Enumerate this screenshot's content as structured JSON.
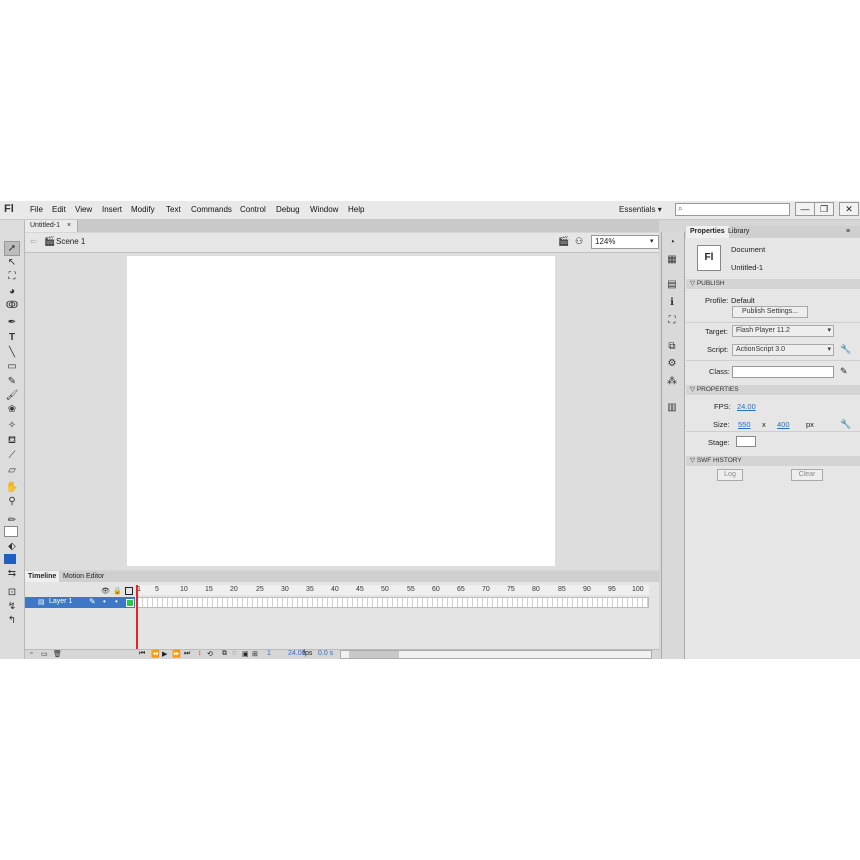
{
  "app": {
    "logo": "Fl"
  },
  "menu": [
    "File",
    "Edit",
    "View",
    "Insert",
    "Modify",
    "Text",
    "Commands",
    "Control",
    "Debug",
    "Window",
    "Help"
  ],
  "workspace": {
    "label": "Essentials",
    "arrow": "▾"
  },
  "search": {
    "placeholder": ""
  },
  "window_controls": {
    "minimize": "—",
    "restore": "❐",
    "close": "✕"
  },
  "document_tab": {
    "title": "Untitled-1",
    "close": "×"
  },
  "scene": {
    "back_arrow": "⇦",
    "name": "Scene 1"
  },
  "zoom": {
    "value": "124%"
  },
  "timeline": {
    "tabs": [
      "Timeline",
      "Motion Editor"
    ],
    "frame_numbers": [
      "1",
      "5",
      "10",
      "15",
      "20",
      "25",
      "30",
      "35",
      "40",
      "45",
      "50",
      "55",
      "60",
      "65",
      "70",
      "75",
      "80",
      "85",
      "90",
      "95",
      "100"
    ],
    "layer": {
      "name": "Layer 1"
    },
    "status": {
      "frame": "1",
      "fps": "24.00",
      "fps_unit": "fps",
      "time": "0.0 s"
    }
  },
  "properties": {
    "tabs": [
      "Properties",
      "Library"
    ],
    "document_label": "Document",
    "document_name": "Untitled-1",
    "document_icon_text": "Fl",
    "publish": {
      "header": "PUBLISH",
      "profile_label": "Profile:",
      "profile_value": "Default",
      "settings_button": "Publish Settings...",
      "target_label": "Target:",
      "target_value": "Flash Player 11.2",
      "script_label": "Script:",
      "script_value": "ActionScript 3.0",
      "class_label": "Class:"
    },
    "props": {
      "header": "PROPERTIES",
      "fps_label": "FPS:",
      "fps_value": "24.00",
      "size_label": "Size:",
      "width": "550",
      "x": "x",
      "height": "400",
      "unit": "px",
      "stage_label": "Stage:",
      "stage_color": "#ffffff"
    },
    "swf_history": {
      "header": "SWF HISTORY",
      "log_button": "Log",
      "clear_button": "Clear"
    }
  },
  "colors": {
    "layer_highlight": "#3c78c6",
    "playhead": "#ee2222",
    "fill_color": "#1f5fbf",
    "link": "#2a6fc9"
  }
}
